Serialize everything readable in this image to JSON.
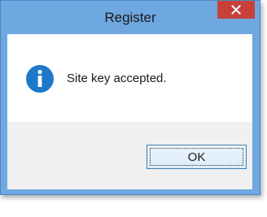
{
  "window": {
    "title": "Register",
    "close_icon": "close-icon"
  },
  "message": {
    "icon": "info-icon",
    "text": "Site key accepted."
  },
  "buttons": {
    "ok_label": "OK"
  },
  "colors": {
    "titlebar": "#6fa7e0",
    "close_button": "#c7413a",
    "info_icon": "#1e78c8",
    "button_area": "#f0f0f0"
  }
}
